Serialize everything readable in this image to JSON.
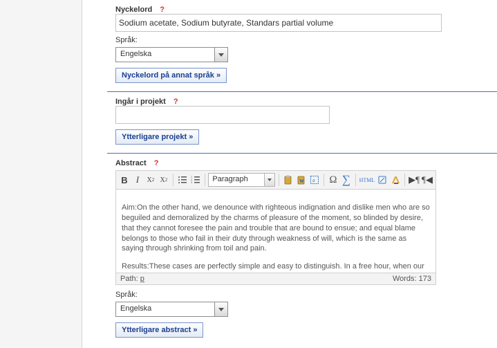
{
  "keywords": {
    "label": "Nyckelord",
    "help": "?",
    "value": "Sodium acetate, Sodium butyrate, Standars partial volume",
    "lang_label": "Språk:",
    "lang_value": "Engelska",
    "more_button": "Nyckelord på annat språk »"
  },
  "project": {
    "label": "Ingår i projekt",
    "help": "?",
    "value": "",
    "more_button": "Ytterligare projekt »"
  },
  "abstract": {
    "label": "Abstract",
    "help": "?",
    "format_selector": "Paragraph",
    "html_label": "HTML",
    "body_para1": "Aim:On the other hand, we denounce with righteous indignation and dislike men who are so beguiled and demoralized by the charms of pleasure of the moment, so blinded by desire, that they cannot foresee the pain and trouble that are bound to ensue; and equal blame belongs to those who fail in their duty through weakness of will, which is the same as saying through shrinking from toil and pain.",
    "body_para2": "Results:These cases are perfectly simple and easy to distinguish. In a free hour, when our power of choice is untrammelled and when nothing prevents our being able to do what we",
    "path_label": "Path:",
    "path_value": "p",
    "words_label": "Words:",
    "words_value": "173",
    "lang_label": "Språk:",
    "lang_value": "Engelska",
    "more_button": "Ytterligare abstract »"
  }
}
